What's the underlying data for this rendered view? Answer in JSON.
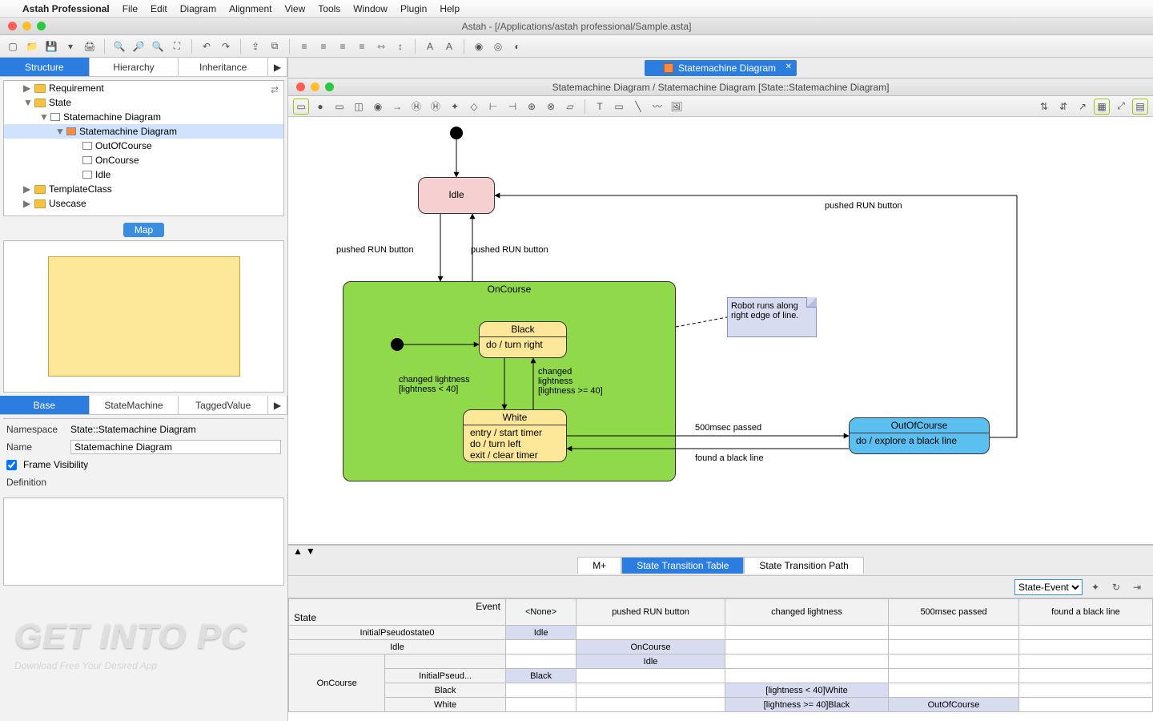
{
  "menubar": {
    "app": "Astah Professional",
    "items": [
      "File",
      "Edit",
      "Diagram",
      "Alignment",
      "View",
      "Tools",
      "Window",
      "Plugin",
      "Help"
    ]
  },
  "window": {
    "title": "Astah - [/Applications/astah professional/Sample.asta]"
  },
  "left": {
    "tabs": {
      "structure": "Structure",
      "hierarchy": "Hierarchy",
      "inheritance": "Inheritance"
    },
    "tree": {
      "requirement": "Requirement",
      "state": "State",
      "smd": "Statemachine Diagram",
      "smd2": "Statemachine Diagram",
      "out": "OutOfCourse",
      "onc": "OnCourse",
      "idle": "Idle",
      "tmpl": "TemplateClass",
      "uc": "Usecase"
    },
    "map": "Map",
    "proptabs": {
      "base": "Base",
      "sm": "StateMachine",
      "tv": "TaggedValue"
    },
    "props": {
      "ns_lbl": "Namespace",
      "ns_val": "State::Statemachine Diagram",
      "name_lbl": "Name",
      "name_val": "Statemachine Diagram",
      "fv_lbl": "Frame Visibility",
      "def_lbl": "Definition"
    }
  },
  "diagram": {
    "tab": "Statemachine Diagram",
    "subtitle": "Statemachine Diagram / Statemachine Diagram [State::Statemachine Diagram]",
    "states": {
      "idle": "Idle",
      "oncourse": "OnCourse",
      "black": "Black",
      "black_body": "do / turn right",
      "white": "White",
      "white_body": "entry / start timer\ndo / turn left\nexit / clear timer",
      "out": "OutOfCourse",
      "out_body": "do / explore a black line"
    },
    "note": "Robot runs along right edge of line.",
    "labels": {
      "run1": "pushed RUN button",
      "run2": "pushed RUN button",
      "run3": "pushed RUN button",
      "cl1": "changed lightness\n[lightness < 40]",
      "cl2": "changed\nlightness\n[lightness >= 40]",
      "pass": "500msec passed",
      "found": "found a black line"
    }
  },
  "dock": {
    "tabs": {
      "mplus": "M+",
      "stt": "State Transition Table",
      "stp": "State Transition Path"
    },
    "select": "State-Event",
    "headers": {
      "corner_ev": "Event",
      "corner_st": "State",
      "none": "<None>",
      "run": "pushed RUN button",
      "cl": "changed lightness",
      "pass": "500msec passed",
      "found": "found a black line"
    },
    "rows": {
      "ips0": "InitialPseudostate0",
      "idle": "Idle",
      "onc": "OnCourse",
      "ips": "InitialPseud...",
      "black": "Black",
      "white": "White"
    },
    "cells": {
      "ips0_none": "Idle",
      "idle_run": "OnCourse",
      "onc_run": "Idle",
      "ips_none": "Black",
      "black_cl": "[lightness < 40]White",
      "white_cl": "[lightness >= 40]Black",
      "white_pass": "OutOfCourse"
    }
  },
  "wm": {
    "big": "GET INTO PC",
    "small": "Download Free Your Desired App"
  }
}
